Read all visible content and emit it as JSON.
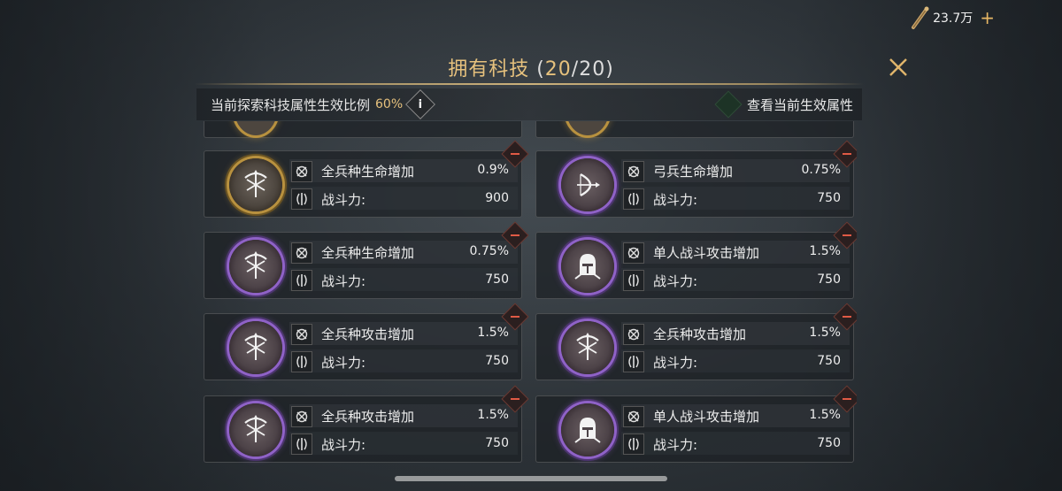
{
  "currency": {
    "amount": "23.7万",
    "plus": "+"
  },
  "title": {
    "text": "拥有科技",
    "open": "(",
    "owned": "20",
    "sep": "/",
    "total": "20",
    "close": ")"
  },
  "info": {
    "label": "当前探索科技属性生效比例",
    "percent": "60%",
    "info_icon": "i",
    "view_label": "查看当前生效属性"
  },
  "cards": [
    {
      "rarity": "gold",
      "icon": "crossbow-icon",
      "attr": "全兵种生命增加",
      "value": "0.9%",
      "power_label": "战斗力:",
      "power": "900"
    },
    {
      "rarity": "purple",
      "icon": "bow-icon",
      "attr": "弓兵生命增加",
      "value": "0.75%",
      "power_label": "战斗力:",
      "power": "750"
    },
    {
      "rarity": "purple",
      "icon": "crossbow-icon",
      "attr": "全兵种生命增加",
      "value": "0.75%",
      "power_label": "战斗力:",
      "power": "750"
    },
    {
      "rarity": "purple",
      "icon": "helmet-icon",
      "attr": "单人战斗攻击增加",
      "value": "1.5%",
      "power_label": "战斗力:",
      "power": "750"
    },
    {
      "rarity": "purple",
      "icon": "crossbow-icon",
      "attr": "全兵种攻击增加",
      "value": "1.5%",
      "power_label": "战斗力:",
      "power": "750"
    },
    {
      "rarity": "purple",
      "icon": "crossbow-icon",
      "attr": "全兵种攻击增加",
      "value": "1.5%",
      "power_label": "战斗力:",
      "power": "750"
    },
    {
      "rarity": "purple",
      "icon": "crossbow-icon",
      "attr": "全兵种攻击增加",
      "value": "1.5%",
      "power_label": "战斗力:",
      "power": "750"
    },
    {
      "rarity": "purple",
      "icon": "helmet-icon",
      "attr": "单人战斗攻击增加",
      "value": "1.5%",
      "power_label": "战斗力:",
      "power": "750"
    }
  ],
  "colors": {
    "gold": "#e6c17d",
    "purple": "#8f62c7",
    "remove": "#e05a45",
    "panel": "#1e2226"
  }
}
